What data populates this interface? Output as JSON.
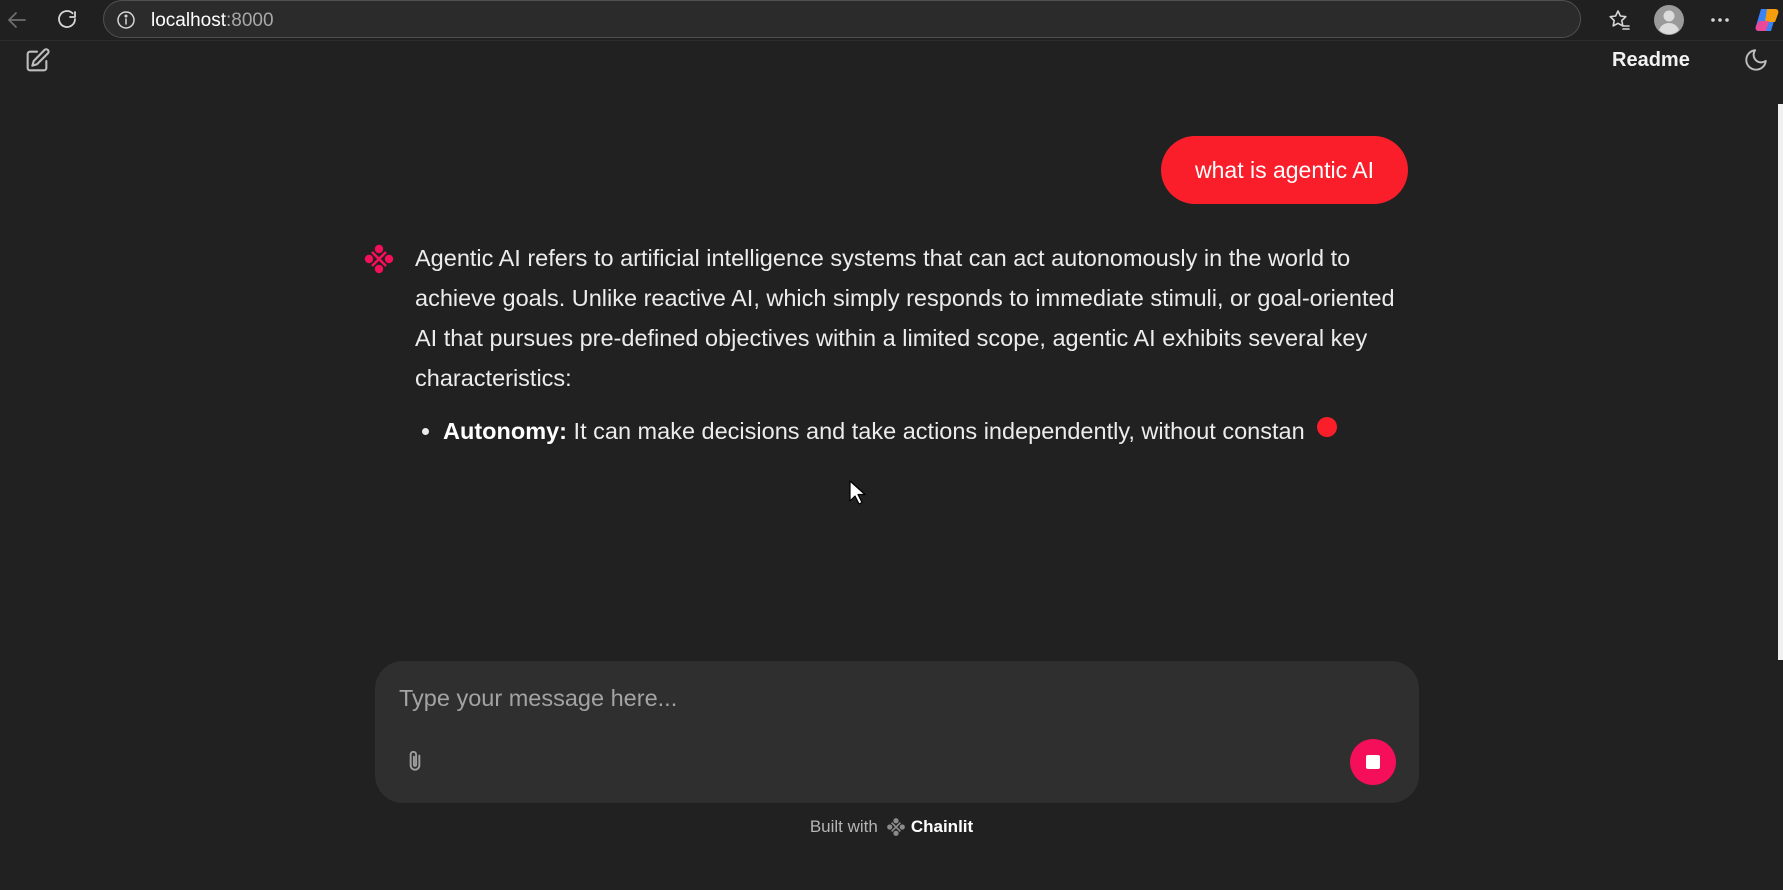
{
  "browser": {
    "url_host": "localhost",
    "url_port": ":8000"
  },
  "header": {
    "readme_label": "Readme"
  },
  "chat": {
    "user_message": "what is agentic AI",
    "assistant_paragraph": "Agentic AI refers to artificial intelligence systems that can act autonomously in the world to achieve goals.  Unlike reactive AI, which simply responds to immediate stimuli, or goal-oriented AI that pursues pre-defined objectives within a limited scope, agentic AI exhibits several key characteristics:",
    "bullets": [
      {
        "term": "Autonomy:",
        "text": " It can make decisions and take actions independently, without constan"
      }
    ]
  },
  "composer": {
    "placeholder": "Type your message here..."
  },
  "footer": {
    "built_with": "Built with",
    "brand": "Chainlit"
  },
  "colors": {
    "background": "#212121",
    "user_bubble": "#fa1e2a",
    "stop_button": "#f50f5a",
    "avatar": "#f50f5a",
    "composer": "#2f2f2f"
  },
  "icons": {
    "back": "arrow-left-icon",
    "reload": "reload-icon",
    "info": "info-icon",
    "favorites": "star-icon",
    "profile": "user-avatar-icon",
    "more": "more-horizontal-icon",
    "copilot": "copilot-icon",
    "new_chat": "edit-square-icon",
    "theme": "moon-icon",
    "avatar": "chainlit-logo-icon",
    "attach": "paperclip-icon",
    "stop": "stop-icon"
  }
}
